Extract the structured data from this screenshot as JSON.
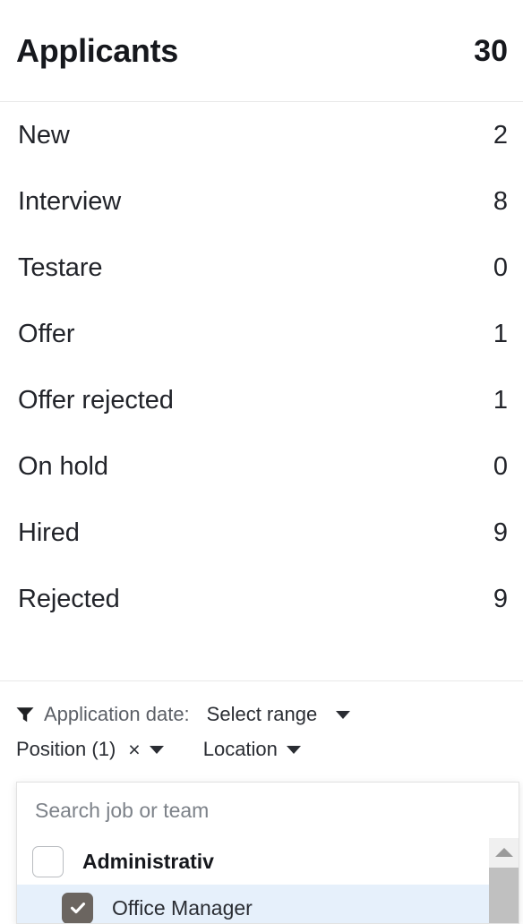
{
  "header": {
    "title": "Applicants",
    "count": "30"
  },
  "statuses": [
    {
      "label": "New",
      "value": "2"
    },
    {
      "label": "Interview",
      "value": "8"
    },
    {
      "label": "Testare",
      "value": "0"
    },
    {
      "label": "Offer",
      "value": "1"
    },
    {
      "label": "Offer rejected",
      "value": "1"
    },
    {
      "label": "On hold",
      "value": "0"
    },
    {
      "label": "Hired",
      "value": "9"
    },
    {
      "label": "Rejected",
      "value": "9"
    }
  ],
  "filters": {
    "funnel_icon": "filter-funnel-icon",
    "date_label": "Application date:",
    "date_value": "Select range",
    "date_caret": "chevron-down-icon",
    "position_label": "Position (1)",
    "position_clear": "×",
    "position_caret": "chevron-down-icon",
    "location_label": "Location",
    "location_caret": "chevron-down-icon"
  },
  "dropdown": {
    "search_placeholder": "Search job or team",
    "search_value": "",
    "options": [
      {
        "label": "Administrativ",
        "checked": false,
        "group": true,
        "highlighted": false
      },
      {
        "label": "Office Manager",
        "checked": true,
        "group": false,
        "highlighted": true
      }
    ],
    "scrollbar": {
      "up_arrow_icon": "scroll-up-arrow-icon"
    }
  },
  "colors": {
    "text": "#1f2023",
    "muted": "#5b5f66",
    "divider": "#e8e8e8",
    "checkbox_checked": "#6b6560",
    "row_highlight": "#e6f0fb",
    "scroll_thumb": "#c0c0c0"
  }
}
